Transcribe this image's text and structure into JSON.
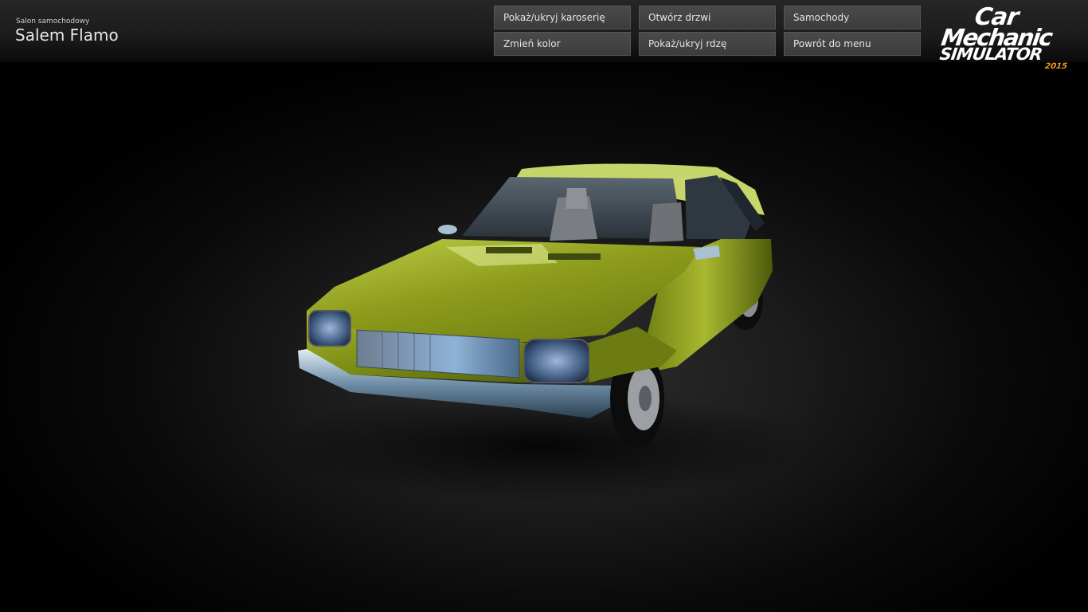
{
  "header": {
    "subtitle": "Salon samochodowy",
    "title": "Salem Flamo"
  },
  "menu": {
    "toggle_body": "Pokaż/ukryj karoserię",
    "open_doors": "Otwórz drzwi",
    "cars": "Samochody",
    "change_color": "Zmień kolor",
    "toggle_rust": "Pokaż/ukryj rdzę",
    "back_to_menu": "Powrót do menu"
  },
  "logo": {
    "line1": "Car",
    "line2": "Mechanic",
    "line3": "SIMULATOR",
    "year": "2015"
  },
  "car": {
    "body_color": "#8a9a1a",
    "highlight_color": "#c8d84a",
    "glass_color": "#3a4a5a"
  }
}
